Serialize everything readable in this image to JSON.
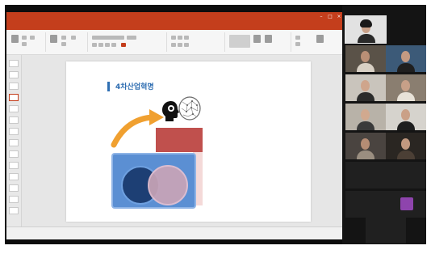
{
  "ppt": {
    "title": "",
    "tabs": [
      "",
      "",
      "",
      "",
      "",
      "",
      "",
      ""
    ],
    "status_left": "",
    "status_right": ""
  },
  "slide": {
    "title": "4차산업혁명",
    "red_box": {
      "line1": "",
      "line2": "",
      "line3": ""
    },
    "blue_box": {
      "header": "",
      "left_circle": "",
      "right_circle": ""
    },
    "note": ""
  },
  "participants": {
    "names": [
      "",
      "",
      "",
      "",
      "",
      "",
      "",
      "",
      "",
      "",
      ""
    ],
    "avatar_initial": ""
  }
}
